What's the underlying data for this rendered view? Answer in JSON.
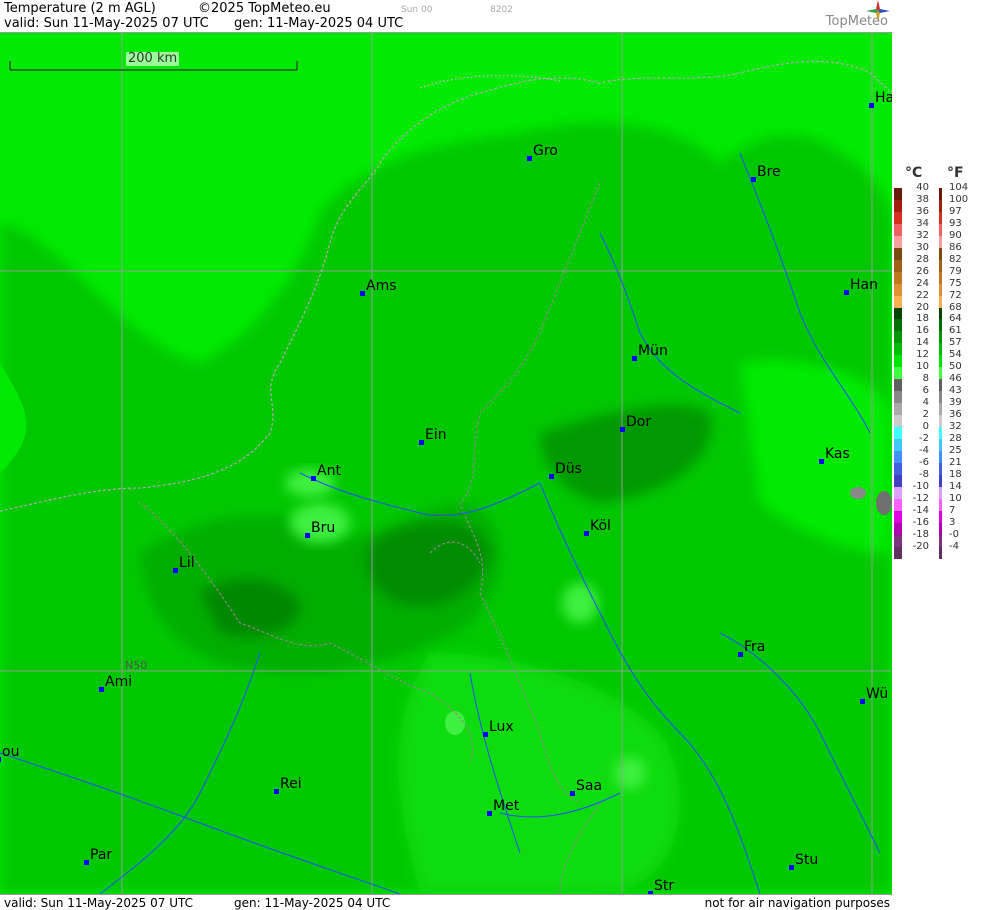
{
  "header": {
    "title": "Temperature (2 m AGL)",
    "copyright": "©2025 TopMeteo.eu",
    "run": "Sun 00",
    "code": "8202",
    "valid": "valid:  Sun  11-May-2025  07 UTC",
    "gen": "gen: 11-May-2025 04 UTC",
    "logo": "TopMeteo"
  },
  "footer": {
    "valid": "valid:  Sun  11-May-2025  07 UTC",
    "gen": "gen: 11-May-2025 04 UTC",
    "disclaimer": "not for air navigation purposes"
  },
  "map": {
    "scale_label": "200 km",
    "lat_label": "N50",
    "cities": [
      {
        "name": "Ha"
      },
      {
        "name": "Gro"
      },
      {
        "name": "Bre"
      },
      {
        "name": "Ams"
      },
      {
        "name": "Han"
      },
      {
        "name": "Mün"
      },
      {
        "name": "Dor"
      },
      {
        "name": "Ein"
      },
      {
        "name": "Ant"
      },
      {
        "name": "Düs"
      },
      {
        "name": "Kas"
      },
      {
        "name": "Bru"
      },
      {
        "name": "Köl"
      },
      {
        "name": "Lil"
      },
      {
        "name": "Fra"
      },
      {
        "name": "Ami"
      },
      {
        "name": "Wü"
      },
      {
        "name": "Lux"
      },
      {
        "name": "ou"
      },
      {
        "name": "Rei"
      },
      {
        "name": "Saa"
      },
      {
        "name": "Met"
      },
      {
        "name": "Par"
      },
      {
        "name": "Stu"
      },
      {
        "name": "Str"
      }
    ]
  },
  "legend": {
    "unit_c": "°C",
    "unit_f": "°F",
    "celsius": [
      "40",
      "38",
      "36",
      "34",
      "32",
      "30",
      "28",
      "26",
      "24",
      "22",
      "20",
      "18",
      "16",
      "14",
      "12",
      "10",
      "8",
      "6",
      "4",
      "2",
      "0",
      "-2",
      "-4",
      "-6",
      "-8",
      "-10",
      "-12",
      "-14",
      "-16",
      "-18",
      "-20"
    ],
    "fahrenheit": [
      "104",
      "100",
      "97",
      "93",
      "90",
      "86",
      "82",
      "79",
      "75",
      "72",
      "68",
      "64",
      "61",
      "57",
      "54",
      "50",
      "46",
      "43",
      "39",
      "36",
      "32",
      "28",
      "25",
      "21",
      "18",
      "14",
      "10",
      "7",
      "3",
      "-0",
      "-4"
    ],
    "colors": [
      "#6b1a0a",
      "#a02010",
      "#d83020",
      "#f06060",
      "#f8a0a0",
      "#7a4a10",
      "#a06018",
      "#c07820",
      "#e09030",
      "#f8b050",
      "#004400",
      "#007000",
      "#009600",
      "#00be00",
      "#00e600",
      "#40ff40",
      "#606060",
      "#888888",
      "#aaaaaa",
      "#cccccc",
      "#40ffff",
      "#40c8ff",
      "#4090ff",
      "#4060e0",
      "#4040c0",
      "#e0a0ff",
      "#ff60ff",
      "#e000e0",
      "#b000b0",
      "#803080",
      "#603060"
    ]
  }
}
